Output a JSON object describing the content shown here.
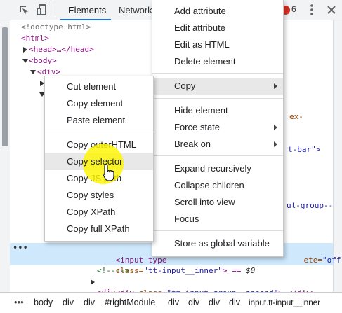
{
  "toolbar": {
    "tabs": [
      "Elements",
      "Network"
    ],
    "active_tab": "Elements",
    "error_count": "6",
    "accent_color": "#1a73e8",
    "error_color": "#d93025"
  },
  "dom_tree": {
    "doctype": "<!doctype html>",
    "html_open": "<html>",
    "head": "<head>…</head>",
    "body_open": "<body>",
    "div_open": "<div>",
    "frag_ex": "ex-",
    "frag_tbar": "t-bar\">",
    "frag_group": "ut-group--",
    "selected": {
      "tag": "<input type",
      "off_attr": "ete=",
      "off_val": "\"off\"",
      "class_attr": "class=",
      "class_val": "\"tt-input__inner\"",
      "close": "> == ",
      "eq": "$0"
    },
    "comment": "<!---->",
    "append_div": {
      "open": "<div ",
      "attr": "class=",
      "val": "\"tt-input-group__append\"",
      "rest": ">…</div>"
    },
    "last_div": "<div"
  },
  "breadcrumb": [
    "body",
    "div",
    "div",
    "#rightModule",
    "div",
    "div",
    "div",
    "div",
    "input.tt-input__inner"
  ],
  "main_menu": {
    "items": [
      {
        "label": "Add attribute"
      },
      {
        "label": "Edit attribute"
      },
      {
        "label": "Edit as HTML"
      },
      {
        "label": "Delete element"
      },
      {
        "label": "Copy"
      },
      {
        "label": "Hide element"
      },
      {
        "label": "Force state"
      },
      {
        "label": "Break on"
      },
      {
        "label": "Expand recursively"
      },
      {
        "label": "Collapse children"
      },
      {
        "label": "Scroll into view"
      },
      {
        "label": "Focus"
      },
      {
        "label": "Store as global variable"
      }
    ]
  },
  "copy_menu": {
    "items": [
      {
        "label": "Cut element"
      },
      {
        "label": "Copy element"
      },
      {
        "label": "Paste element"
      },
      {
        "label": "Copy outerHTML"
      },
      {
        "label": "Copy selector"
      },
      {
        "label": "Copy JS path"
      },
      {
        "label": "Copy styles"
      },
      {
        "label": "Copy XPath"
      },
      {
        "label": "Copy full XPath"
      }
    ]
  },
  "icons": {
    "inspect": "inspect-element-icon",
    "device": "device-toolbar-icon",
    "error": "error-badge-icon",
    "more": "more-vertical-icon",
    "close": "close-icon"
  }
}
